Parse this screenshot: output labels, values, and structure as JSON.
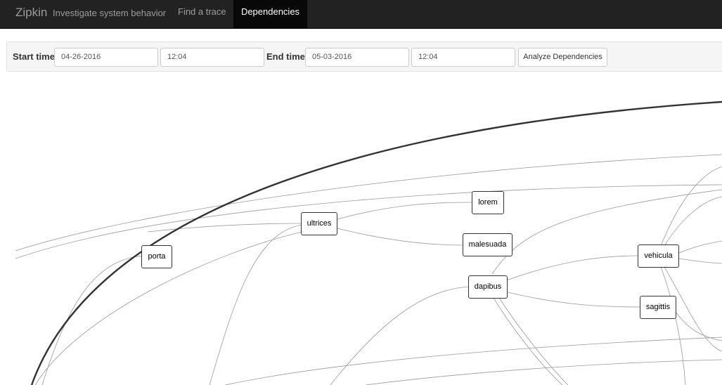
{
  "navbar": {
    "brand": "Zipkin",
    "tagline": "Investigate system behavior",
    "links": [
      {
        "label": "Find a trace",
        "active": false
      },
      {
        "label": "Dependencies",
        "active": true
      }
    ]
  },
  "controls": {
    "start_label": "Start time",
    "start_date": "04-26-2016",
    "start_time": "12:04",
    "end_label": "End time",
    "end_date": "05-03-2016",
    "end_time": "12:04",
    "analyze_label": "Analyze Dependencies"
  },
  "graph": {
    "nodes": [
      "porta",
      "ultrices",
      "lorem",
      "malesuada",
      "dapibus",
      "vehicula",
      "sagittis"
    ]
  }
}
